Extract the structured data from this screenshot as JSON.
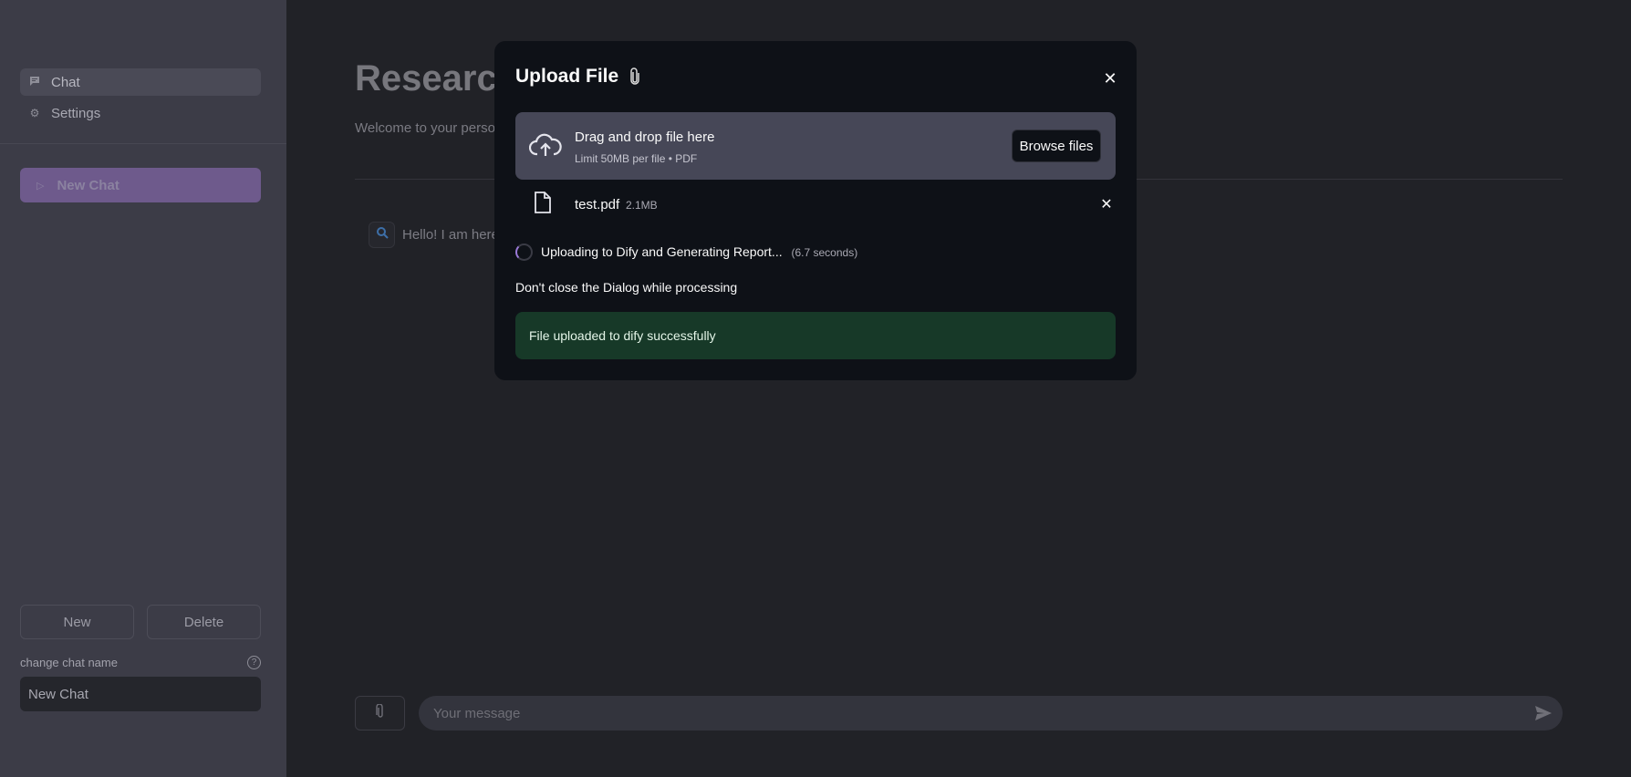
{
  "sidebar": {
    "nav": [
      {
        "label": "Chat",
        "icon": "chat-bubble-icon",
        "active": true
      },
      {
        "label": "Settings",
        "icon": "gear-icon",
        "active": false
      }
    ],
    "new_chat_button": "New Chat",
    "new_button": "New",
    "delete_button": "Delete",
    "rename_label": "change chat name",
    "rename_value": "New Chat"
  },
  "main": {
    "title": "Research",
    "subtitle": "Welcome to your persona",
    "assistant_message": "Hello! I am here",
    "input_placeholder": "Your message"
  },
  "dialog": {
    "title": "Upload File",
    "dropzone_title": "Drag and drop file here",
    "dropzone_limit": "Limit 50MB per file • PDF",
    "browse_button": "Browse files",
    "file": {
      "name": "test.pdf",
      "size": "2.1MB"
    },
    "status": "Uploading to Dify and Generating Report...",
    "status_time": "(6.7 seconds)",
    "warning": "Don't close the Dialog while processing",
    "success": "File uploaded to dify successfully"
  },
  "colors": {
    "background": "#212227",
    "sidebar": "#3c3c47",
    "dialog": "#0e1117",
    "accent": "#6e5a8c",
    "success": "#173928"
  }
}
